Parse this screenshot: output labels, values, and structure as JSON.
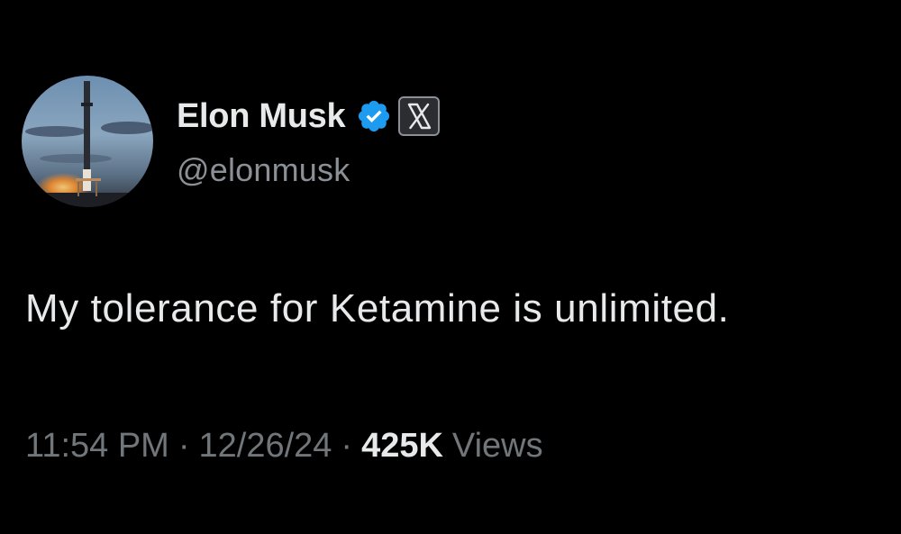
{
  "author": {
    "display_name": "Elon Musk",
    "handle": "@elonmusk",
    "verified_icon": "verified-badge-icon",
    "affiliate_icon": "x-logo-icon"
  },
  "tweet": {
    "text": "My tolerance for Ketamine is unlimited."
  },
  "meta": {
    "time": "11:54 PM",
    "separator": "·",
    "date": "12/26/24",
    "views_count": "425K",
    "views_label": "Views"
  },
  "colors": {
    "background": "#000000",
    "primary_text": "#e7e9ea",
    "secondary_text": "#71767b",
    "verified_blue": "#1d9bf0"
  }
}
